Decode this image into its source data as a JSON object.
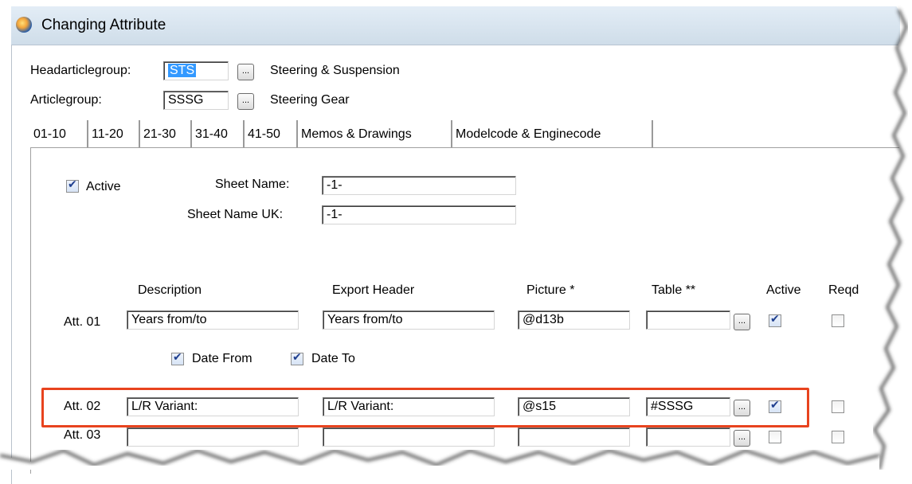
{
  "window": {
    "title": "Changing Attribute"
  },
  "header": {
    "headarticlegroup": {
      "label": "Headarticlegroup:",
      "code": "STS",
      "browse": "...",
      "description": "Steering & Suspension"
    },
    "articlegroup": {
      "label": "Articlegroup:",
      "code": "SSSG",
      "browse": "...",
      "description": "Steering Gear"
    }
  },
  "tabs": [
    {
      "label": "01-10",
      "active": true
    },
    {
      "label": "11-20"
    },
    {
      "label": "21-30"
    },
    {
      "label": "31-40"
    },
    {
      "label": "41-50"
    },
    {
      "label": "Memos & Drawings"
    },
    {
      "label": "Modelcode & Enginecode"
    }
  ],
  "sheet": {
    "active_label": "Active",
    "active_checked": true,
    "name_label": "Sheet Name:",
    "name_value": "-1-",
    "name_uk_label": "Sheet Name UK:",
    "name_uk_value": "-1-"
  },
  "columns": {
    "description": "Description",
    "export_header": "Export Header",
    "picture": "Picture *",
    "table": "Table **",
    "active": "Active",
    "reqd": "Reqd"
  },
  "rows": [
    {
      "label": "Att. 01",
      "description": "Years from/to",
      "export_header": "Years from/to",
      "picture": "@d13b",
      "table": "",
      "browse": "...",
      "active": true,
      "reqd": false
    },
    {
      "label": "Att. 02",
      "description": "L/R Variant:",
      "export_header": "L/R Variant:",
      "picture": "@s15",
      "table": "#SSSG",
      "browse": "...",
      "active": true,
      "reqd": false
    },
    {
      "label": "Att. 03",
      "description": "",
      "export_header": "",
      "picture": "",
      "table": "",
      "browse": "...",
      "active": false,
      "reqd": false
    }
  ],
  "date_options": {
    "date_from_label": "Date From",
    "date_from_checked": true,
    "date_to_label": "Date To",
    "date_to_checked": true
  },
  "annotation": {
    "highlight_color": "#e8431e",
    "highlighted_row": "Att. 02"
  }
}
